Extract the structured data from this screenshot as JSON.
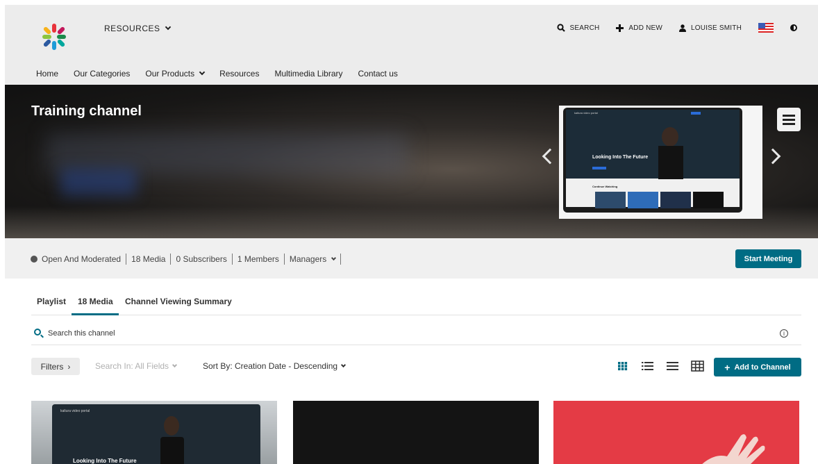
{
  "header": {
    "resources_label": "RESOURCES",
    "actions": {
      "search": "SEARCH",
      "add_new": "ADD NEW",
      "user": "LOUISE SMITH"
    }
  },
  "nav": {
    "items": [
      "Home",
      "Our Categories",
      "Our Products",
      "Resources",
      "Multimedia Library",
      "Contact us"
    ]
  },
  "hero": {
    "title": "Training channel",
    "thumb_heading": "Looking Into The Future",
    "thumb_brand": "kaltura video portal",
    "thumb_row_label": "Continue Watching"
  },
  "channel_info": {
    "privacy": "Open And Moderated",
    "media": "18  Media",
    "subscribers": "0  Subscribers",
    "members": "1  Members",
    "managers": "Managers",
    "start_meeting": "Start Meeting"
  },
  "tabs": {
    "playlist": "Playlist",
    "media": "18 Media",
    "summary": "Channel Viewing Summary"
  },
  "search": {
    "placeholder": "Search this channel"
  },
  "toolbar": {
    "filters": "Filters",
    "search_in": "Search In: All Fields",
    "sort_by": "Sort By: Creation Date - Descending",
    "add_to_channel": "Add to Channel"
  },
  "cards": {
    "first_title": "Looking Into The Future",
    "first_brand": "kaltura video portal"
  },
  "colors": {
    "accent": "#006c84",
    "header_bg": "#ececec",
    "infobar_bg": "#f0f0f0",
    "card3_bg": "#e43b45"
  },
  "icons": [
    "logo-icon",
    "chevron-down-icon",
    "search-icon",
    "plus-icon",
    "user-icon",
    "us-flag-icon",
    "contrast-icon",
    "chevron-left-icon",
    "chevron-right-icon",
    "menu-icon",
    "globe-icon",
    "info-icon",
    "grid-view-icon",
    "list-view-icon",
    "compact-view-icon",
    "table-view-icon"
  ]
}
